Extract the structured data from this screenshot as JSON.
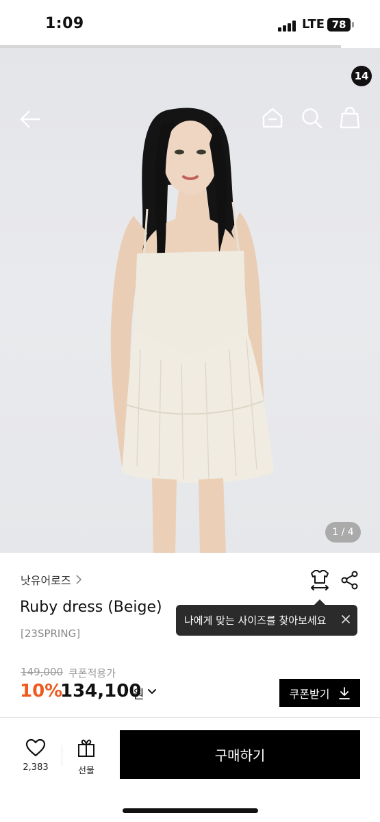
{
  "status_bar": {
    "time": "1:09",
    "network": "LTE",
    "battery": "78"
  },
  "header": {
    "back_icon": "arrow-left-icon",
    "home_icon": "home-icon",
    "search_icon": "search-icon",
    "cart_icon": "shopping-bag-icon",
    "cart_count": "14"
  },
  "gallery": {
    "page_indicator": "1 / 4",
    "current": 1,
    "total": 4
  },
  "product": {
    "brand": "낫유어로즈",
    "title": "Ruby dress (Beige)",
    "season": "[23SPRING]",
    "original_price": "149,000",
    "coupon_label": "쿠폰적용가",
    "discount": "10%",
    "price": "134,100",
    "currency": "원",
    "coupon_button": "쿠폰받기"
  },
  "tooltip": {
    "text": "나에게 맞는 사이즈를 찾아보세요"
  },
  "actions": {
    "size_icon": "size-fit-icon",
    "share_icon": "share-icon"
  },
  "bottom_bar": {
    "like_count": "2,383",
    "gift_label": "선물",
    "buy_label": "구매하기"
  },
  "colors": {
    "accent": "#ee5a1f",
    "primary": "#000000"
  }
}
